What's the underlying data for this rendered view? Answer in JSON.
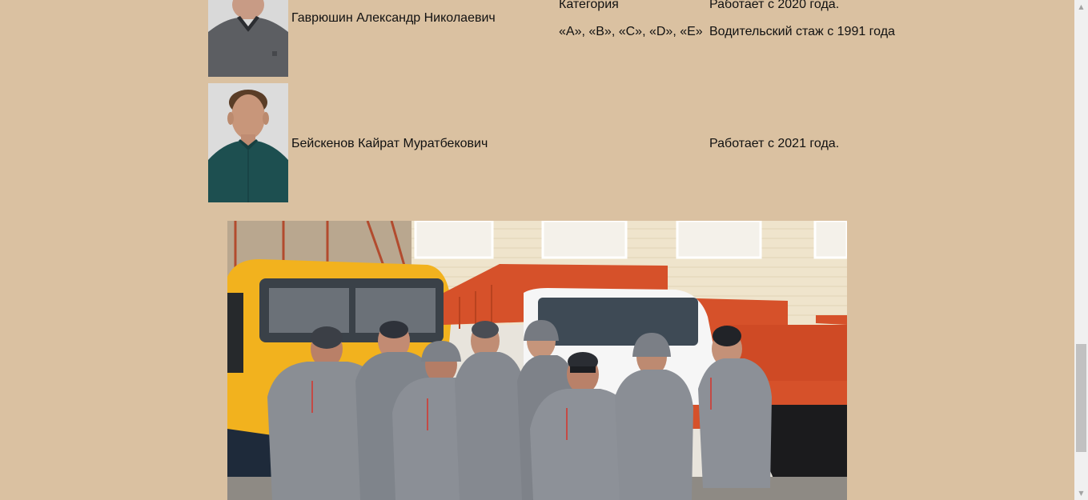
{
  "employees": [
    {
      "name": "Гаврюшин Александр Николаевич",
      "category_label": "Категория",
      "category_value": "«A», «B», «C», «D», «E»",
      "works_since": "Работает с 2020 года.",
      "driving_experience": "Водительский стаж с 1991 года"
    },
    {
      "name": "Бейскенов Кайрат Муратбекович",
      "works_since": "Работает с 2021 года."
    }
  ],
  "scrollbar": {
    "up_arrow": "▲",
    "down_arrow": "▼"
  }
}
